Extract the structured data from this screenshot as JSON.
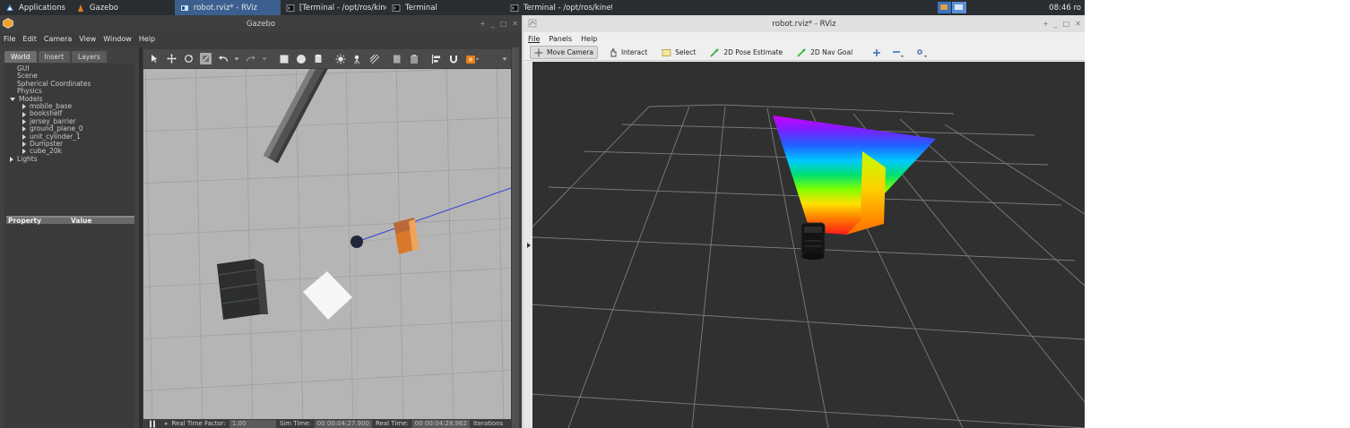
{
  "taskbar": {
    "apps_label": "Applications",
    "items": [
      {
        "label": "Gazebo",
        "icon": "gazebo-icon",
        "active": false
      },
      {
        "label": "robot.rviz* - RViz",
        "icon": "rviz-icon",
        "active": true
      },
      {
        "label": "[Terminal - /opt/ros/kine...",
        "icon": "terminal-icon",
        "active": false
      },
      {
        "label": "Terminal",
        "icon": "terminal-icon",
        "active": false
      },
      {
        "label": "Terminal - /opt/ros/kinet...",
        "icon": "terminal-icon",
        "active": false
      }
    ],
    "clock": "08:46 ro"
  },
  "gazebo": {
    "title": "Gazebo",
    "menu": [
      "File",
      "Edit",
      "Camera",
      "View",
      "Window",
      "Help"
    ],
    "tabs": [
      "World",
      "Insert",
      "Layers"
    ],
    "tree": [
      {
        "label": "GUI",
        "level": 0,
        "arrow": "none"
      },
      {
        "label": "Scene",
        "level": 0,
        "arrow": "none"
      },
      {
        "label": "Spherical Coordinates",
        "level": 0,
        "arrow": "none"
      },
      {
        "label": "Physics",
        "level": 0,
        "arrow": "none"
      },
      {
        "label": "Models",
        "level": 0,
        "arrow": "down"
      },
      {
        "label": "mobile_base",
        "level": 1,
        "arrow": "right"
      },
      {
        "label": "bookshelf",
        "level": 1,
        "arrow": "right"
      },
      {
        "label": "jersey_barrier",
        "level": 1,
        "arrow": "right"
      },
      {
        "label": "ground_plane_0",
        "level": 1,
        "arrow": "right"
      },
      {
        "label": "unit_cylinder_1",
        "level": 1,
        "arrow": "right"
      },
      {
        "label": "Dumpster",
        "level": 1,
        "arrow": "right"
      },
      {
        "label": "cube_20k",
        "level": 1,
        "arrow": "right"
      },
      {
        "label": "Lights",
        "level": 0,
        "arrow": "right"
      }
    ],
    "properties": {
      "property_label": "Property",
      "value_label": "Value"
    },
    "status": {
      "rtf_label": "Real Time Factor:",
      "rtf_value": "1.00",
      "sim_label": "Sim Time:",
      "sim_value": "00 00:04:27.900",
      "real_label": "Real Time:",
      "real_value": "00 00:04:28.962",
      "iter_label": "Iterations"
    }
  },
  "rviz": {
    "title": "robot.rviz* - RViz",
    "menu": [
      "File",
      "Panels",
      "Help"
    ],
    "tools": [
      {
        "label": "Move Camera",
        "icon": "move-camera-icon",
        "selected": true
      },
      {
        "label": "Interact",
        "icon": "interact-icon",
        "selected": false
      },
      {
        "label": "Select",
        "icon": "select-icon",
        "selected": false
      },
      {
        "label": "2D Pose Estimate",
        "icon": "pose-estimate-icon",
        "selected": false
      },
      {
        "label": "2D Nav Goal",
        "icon": "nav-goal-icon",
        "selected": false
      }
    ]
  }
}
